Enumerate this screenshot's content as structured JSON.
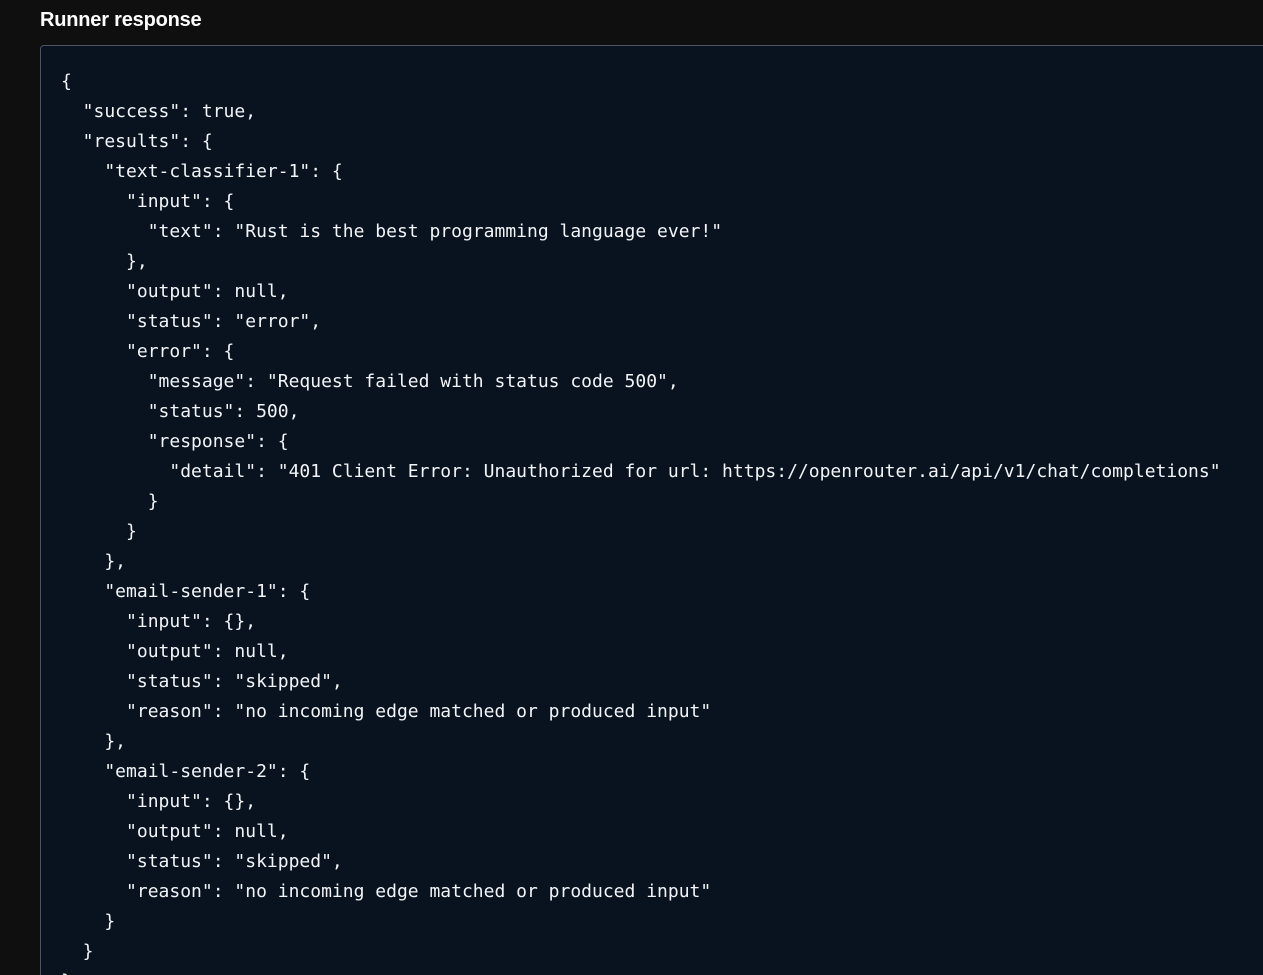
{
  "panel": {
    "title": "Runner response"
  },
  "code": {
    "lines": [
      "{",
      "  \"success\": true,",
      "  \"results\": {",
      "    \"text-classifier-1\": {",
      "      \"input\": {",
      "        \"text\": \"Rust is the best programming language ever!\"",
      "      },",
      "      \"output\": null,",
      "      \"status\": \"error\",",
      "      \"error\": {",
      "        \"message\": \"Request failed with status code 500\",",
      "        \"status\": 500,",
      "        \"response\": {",
      "          \"detail\": \"401 Client Error: Unauthorized for url: https://openrouter.ai/api/v1/chat/completions\"",
      "        }",
      "      }",
      "    },",
      "    \"email-sender-1\": {",
      "      \"input\": {},",
      "      \"output\": null,",
      "      \"status\": \"skipped\",",
      "      \"reason\": \"no incoming edge matched or produced input\"",
      "    },",
      "    \"email-sender-2\": {",
      "      \"input\": {},",
      "      \"output\": null,",
      "      \"status\": \"skipped\",",
      "      \"reason\": \"no incoming edge matched or produced input\"",
      "    }",
      "  }",
      "}"
    ]
  }
}
